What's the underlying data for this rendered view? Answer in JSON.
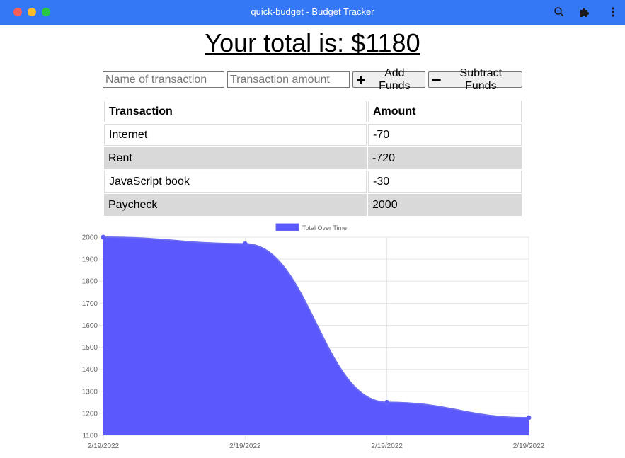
{
  "window": {
    "title": "quick-budget - Budget Tracker"
  },
  "header": {
    "total_text": "Your total is: $1180"
  },
  "form": {
    "name_placeholder": "Name of transaction",
    "amount_placeholder": "Transaction amount",
    "add_label": "Add Funds",
    "subtract_label": "Subtract Funds"
  },
  "table": {
    "headers": [
      "Transaction",
      "Amount"
    ],
    "rows": [
      {
        "name": "Internet",
        "amount": "-70"
      },
      {
        "name": "Rent",
        "amount": "-720"
      },
      {
        "name": "JavaScript book",
        "amount": "-30"
      },
      {
        "name": "Paycheck",
        "amount": "2000"
      }
    ]
  },
  "colors": {
    "titlebar": "#3478f6",
    "series_fill": "#5b59fe",
    "series_line": "#6c6cf0"
  },
  "chart_data": {
    "type": "area",
    "x": [
      "2/19/2022",
      "2/19/2022",
      "2/19/2022",
      "2/19/2022"
    ],
    "series": [
      {
        "name": "Total Over Time",
        "values": [
          2000,
          1970,
          1250,
          1180
        ]
      }
    ],
    "yticks": [
      2000,
      1900,
      1800,
      1700,
      1600,
      1500,
      1400,
      1300,
      1200,
      1100
    ],
    "ylim": [
      1100,
      2000
    ],
    "legend": "top-center",
    "grid": true
  }
}
